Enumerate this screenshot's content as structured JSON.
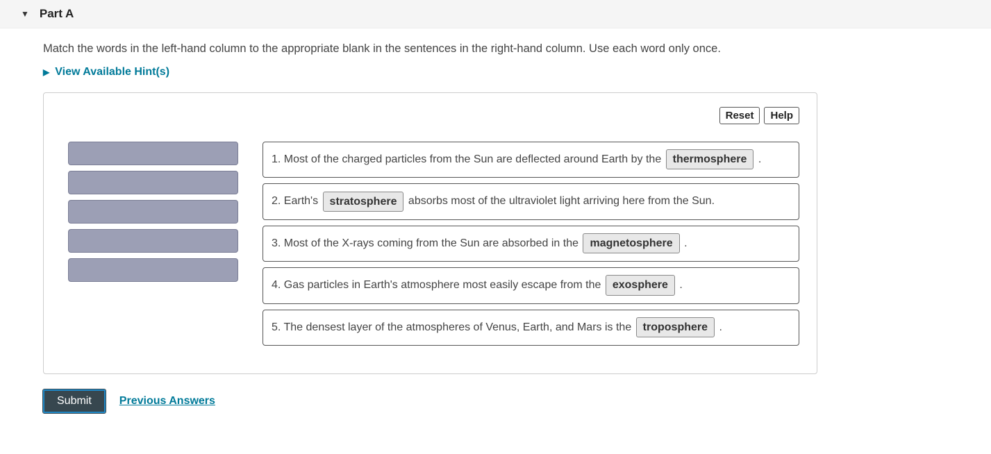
{
  "header": {
    "part_label": "Part A"
  },
  "instructions": "Match the words in the left-hand column to the appropriate blank in the sentences in the right-hand column. Use each word only once.",
  "hints_link": "View Available Hint(s)",
  "toolbar": {
    "reset": "Reset",
    "help": "Help"
  },
  "sentences": [
    {
      "num": "1.",
      "pre": "Most of the charged particles from the Sun are deflected around Earth by the",
      "word": "thermosphere",
      "post": "."
    },
    {
      "num": "2.",
      "pre": "Earth's",
      "word": "stratosphere",
      "post": "absorbs most of the ultraviolet light arriving here from the Sun."
    },
    {
      "num": "3.",
      "pre": "Most of the X-rays coming from the Sun are absorbed in the",
      "word": "magnetosphere",
      "post": "."
    },
    {
      "num": "4.",
      "pre": "Gas particles in Earth's atmosphere most easily escape from the",
      "word": "exosphere",
      "post": "."
    },
    {
      "num": "5.",
      "pre": "The densest layer of the atmospheres of Venus, Earth, and Mars is the",
      "word": "troposphere",
      "post": "."
    }
  ],
  "footer": {
    "submit": "Submit",
    "previous": "Previous Answers"
  }
}
